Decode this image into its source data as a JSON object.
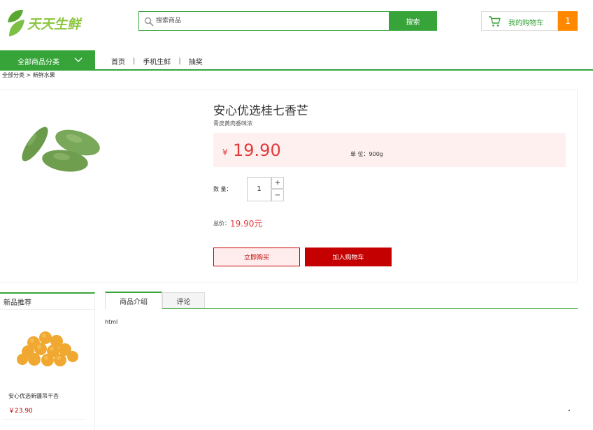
{
  "header": {
    "logo_text": "天天生鲜",
    "search_placeholder": "搜索商品",
    "search_button": "搜索",
    "cart_label": "我的购物车",
    "cart_count": "1"
  },
  "nav": {
    "category_button": "全部商品分类",
    "items": [
      "首页",
      "手机生鲜",
      "抽奖"
    ],
    "separator": "|"
  },
  "breadcrumb": "全部分类 > 新鲜水果",
  "product": {
    "name": "安心优选桂七香芒",
    "desc": "青皮黄肉香味浓",
    "currency": "¥",
    "price": "19.90",
    "unit": "单  位：900g",
    "qty_label": "数 量：",
    "qty_value": "1",
    "qty_plus": "+",
    "qty_minus": "−",
    "total_label": "总价：",
    "total_value": "19.90元",
    "buy_now": "立即购买",
    "add_cart": "加入购物车"
  },
  "new_products": {
    "title": "新品推荐",
    "items": [
      {
        "name": "安心优选新疆吊干杏",
        "price": "￥23.90"
      }
    ]
  },
  "tabs": {
    "items": [
      "商品介绍",
      "评论"
    ],
    "active": "商品介绍",
    "content": "html"
  },
  "colors": {
    "brand_green": "#37a43a",
    "cart_orange": "#ff8800",
    "price_red": "#e4393c",
    "button_red": "#c40000"
  }
}
